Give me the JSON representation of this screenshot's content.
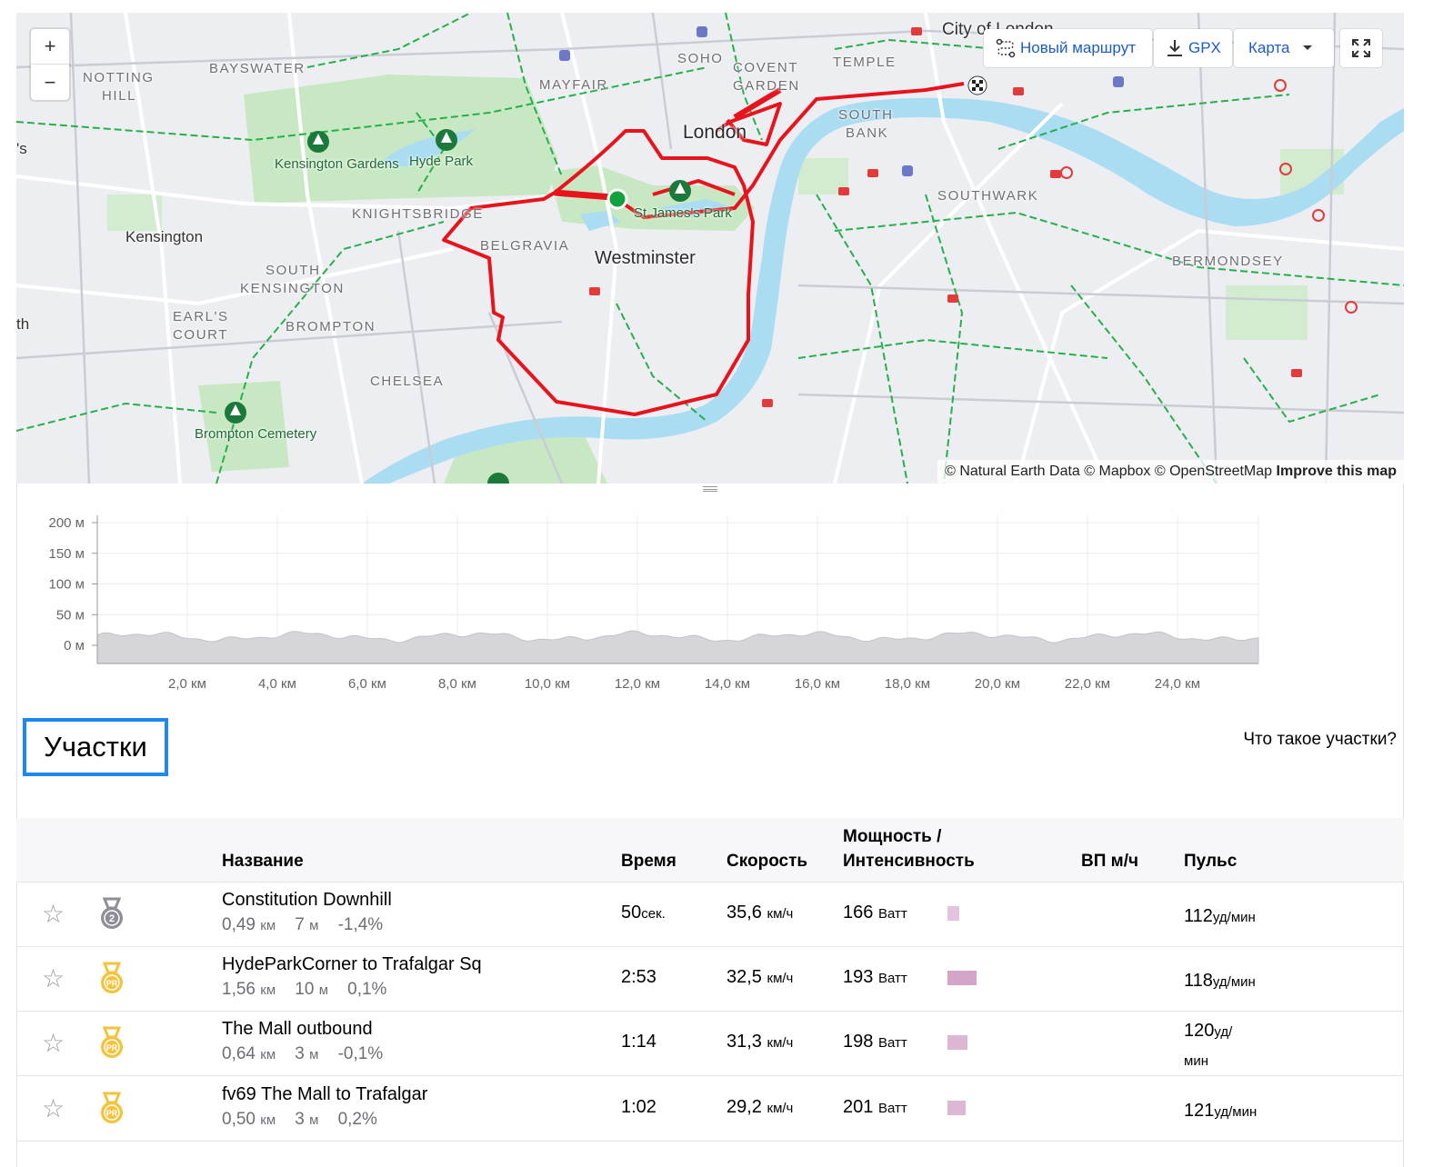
{
  "map": {
    "zoom_in": "+",
    "zoom_out": "−",
    "buttons": {
      "new_route": "Новый маршрут",
      "gpx": "GPX",
      "map_type": "Карта"
    },
    "attribution": {
      "text": "© Natural Earth Data © Mapbox © OpenStreetMap",
      "link": "Improve this map"
    },
    "labels": {
      "city_of_london": "City of London",
      "temple": "TEMPLE",
      "soho": "SOHO",
      "covent": "COVENT",
      "garden": "GARDEN",
      "mayfair": "MAYFAIR",
      "bayswater": "BAYSWATER",
      "notting": "NOTTING",
      "hill": "HILL",
      "london": "London",
      "south": "SOUTH",
      "bank": "BANK",
      "kensington_gardens": "Kensington Gardens",
      "hyde_park": "Hyde Park",
      "knightsbridge": "KNIGHTSBRIDGE",
      "st_james_park": "St James's Park",
      "southwark": "SOUTHWARK",
      "kensington": "Kensington",
      "belgravia": "BELGRAVIA",
      "westminster": "Westminster",
      "south_kensington_1": "SOUTH",
      "south_kensington_2": "KENSINGTON",
      "bermondsey": "BERMONDSEY",
      "earls": "EARL'S",
      "court": "COURT",
      "brompton": "BROMPTON",
      "chelsea": "CHELSEA",
      "brompton_cemetery": "Brompton Cemetery",
      "edge_s": "'s",
      "edge_th": "th"
    }
  },
  "elevation": {
    "y_ticks": [
      "200 м",
      "150 м",
      "100 м",
      "50 м",
      "0 м"
    ],
    "x_ticks": [
      "2,0 км",
      "4,0 км",
      "6,0 км",
      "8,0 км",
      "10,0 км",
      "12,0 км",
      "14,0 км",
      "16,0 км",
      "18,0 км",
      "20,0 км",
      "22,0 км",
      "24,0 км"
    ],
    "ylim": [
      0,
      200
    ],
    "xlim": [
      0,
      25.8
    ]
  },
  "segments": {
    "title": "Участки",
    "help_link": "Что такое участки?",
    "columns": {
      "name": "Название",
      "time": "Время",
      "speed": "Скорость",
      "power_1": "Мощность /",
      "power_2": "Интенсивность",
      "vam": "ВП м/ч",
      "hr": "Пульс"
    },
    "rows": [
      {
        "name": "Constitution Downhill",
        "dist": "0,49",
        "dist_unit": "км",
        "elev": "7",
        "elev_unit": "м",
        "grade": "-1,4%",
        "time": "50",
        "time_unit": "сек.",
        "speed": "35,6",
        "speed_unit": "км/ч",
        "power": "166",
        "power_unit": "Ватт",
        "intensity": 0.18,
        "hr": "112",
        "hr_unit": "уд/мин",
        "medal": "2",
        "medal_color": "#8e8e96"
      },
      {
        "name": "HydeParkCorner to Trafalgar Sq",
        "dist": "1,56",
        "dist_unit": "км",
        "elev": "10",
        "elev_unit": "м",
        "grade": "0,1%",
        "time": "2:53",
        "time_unit": "",
        "speed": "32,5",
        "speed_unit": "км/ч",
        "power": "193",
        "power_unit": "Ватт",
        "intensity": 0.45,
        "hr": "118",
        "hr_unit": "уд/мин",
        "medal": "PR",
        "medal_color": "#f5c33b"
      },
      {
        "name": "The Mall outbound",
        "dist": "0,64",
        "dist_unit": "км",
        "elev": "3",
        "elev_unit": "м",
        "grade": "-0,1%",
        "time": "1:14",
        "time_unit": "",
        "speed": "31,3",
        "speed_unit": "км/ч",
        "power": "198",
        "power_unit": "Ватт",
        "intensity": 0.3,
        "hr": "120",
        "hr_unit": "уд/",
        "hr_unit_2": "мин",
        "medal": "PR",
        "medal_color": "#f5c33b"
      },
      {
        "name": "fv69 The Mall to Trafalgar",
        "dist": "0,50",
        "dist_unit": "км",
        "elev": "3",
        "elev_unit": "м",
        "grade": "0,2%",
        "time": "1:02",
        "time_unit": "",
        "speed": "29,2",
        "speed_unit": "км/ч",
        "power": "201",
        "power_unit": "Ватт",
        "intensity": 0.28,
        "hr": "121",
        "hr_unit": "уд/мин",
        "medal": "PR",
        "medal_color": "#f5c33b"
      }
    ]
  },
  "colors": {
    "route": "#e8141d",
    "water": "#aadcf2",
    "park": "#c8e8c4",
    "accent": "#1e88ef",
    "link": "#1a5dc9",
    "intensity_bar": "#c98fbc"
  }
}
